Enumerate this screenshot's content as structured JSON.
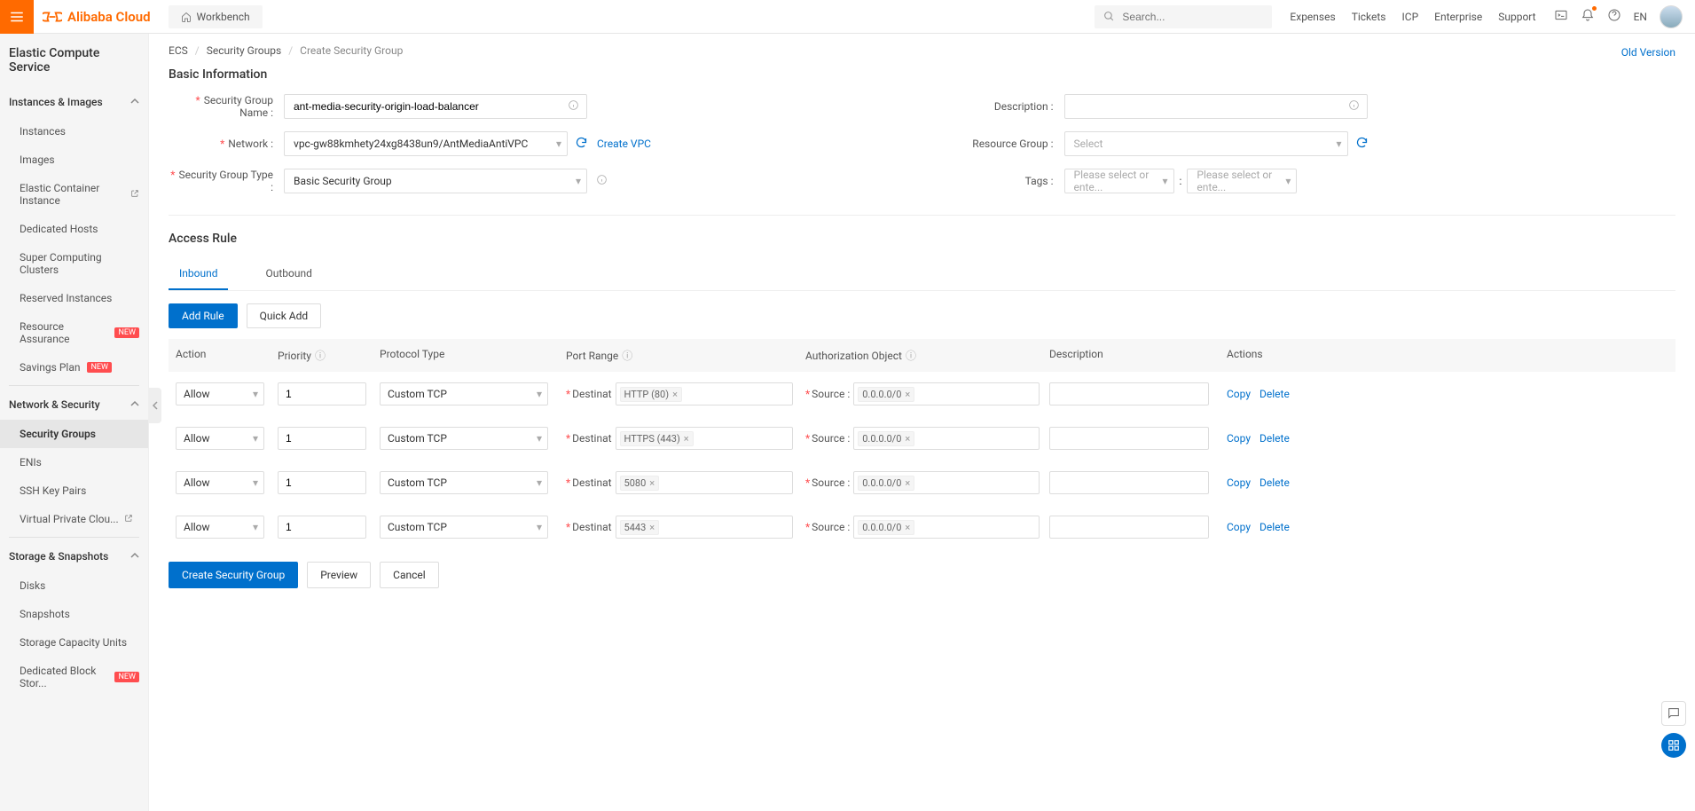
{
  "header": {
    "brand": "Alibaba Cloud",
    "workbench": "Workbench",
    "search_placeholder": "Search...",
    "links": [
      "Expenses",
      "Tickets",
      "ICP",
      "Enterprise",
      "Support"
    ],
    "lang": "EN"
  },
  "sidebar": {
    "title": "Elastic Compute Service",
    "sections": [
      {
        "label": "Instances & Images",
        "expanded": true,
        "items": [
          {
            "label": "Instances"
          },
          {
            "label": "Images"
          },
          {
            "label": "Elastic Container Instance",
            "external": true
          },
          {
            "label": "Dedicated Hosts"
          },
          {
            "label": "Super Computing Clusters"
          },
          {
            "label": "Reserved Instances"
          },
          {
            "label": "Resource Assurance",
            "badge": "NEW"
          },
          {
            "label": "Savings Plan",
            "badge": "NEW"
          }
        ]
      },
      {
        "label": "Network & Security",
        "expanded": true,
        "items": [
          {
            "label": "Security Groups",
            "active": true
          },
          {
            "label": "ENIs"
          },
          {
            "label": "SSH Key Pairs"
          },
          {
            "label": "Virtual Private Clou...",
            "external": true
          }
        ]
      },
      {
        "label": "Storage & Snapshots",
        "expanded": true,
        "items": [
          {
            "label": "Disks"
          },
          {
            "label": "Snapshots"
          },
          {
            "label": "Storage Capacity Units"
          },
          {
            "label": "Dedicated Block Stor...",
            "badge": "NEW"
          }
        ]
      }
    ]
  },
  "breadcrumb": {
    "items": [
      "ECS",
      "Security Groups",
      "Create Security Group"
    ]
  },
  "old_version": "Old Version",
  "basic": {
    "title": "Basic Information",
    "labels": {
      "name": "Security Group Name :",
      "description": "Description :",
      "network": "Network :",
      "resource_group": "Resource Group :",
      "type": "Security Group Type :",
      "tags": "Tags :"
    },
    "values": {
      "name": "ant-media-security-origin-load-balancer",
      "network": "vpc-gw88kmhety24xg8438un9/AntMediaAntiVPC",
      "type": "Basic Security Group"
    },
    "create_vpc": "Create VPC",
    "select_placeholder": "Select",
    "tag_placeholder": "Please select or ente..."
  },
  "access": {
    "title": "Access Rule",
    "tabs": {
      "inbound": "Inbound",
      "outbound": "Outbound"
    },
    "add_rule": "Add Rule",
    "quick_add": "Quick Add",
    "columns": {
      "action": "Action",
      "priority": "Priority",
      "protocol": "Protocol Type",
      "port": "Port Range",
      "auth": "Authorization Object",
      "desc": "Description",
      "actions": "Actions"
    },
    "port_label": "Destinat",
    "source_label": "Source :",
    "row_actions": {
      "copy": "Copy",
      "delete": "Delete"
    },
    "rows": [
      {
        "action": "Allow",
        "priority": "1",
        "protocol": "Custom TCP",
        "port": "HTTP (80)",
        "source": "0.0.0.0/0"
      },
      {
        "action": "Allow",
        "priority": "1",
        "protocol": "Custom TCP",
        "port": "HTTPS (443)",
        "source": "0.0.0.0/0"
      },
      {
        "action": "Allow",
        "priority": "1",
        "protocol": "Custom TCP",
        "port": "5080",
        "source": "0.0.0.0/0"
      },
      {
        "action": "Allow",
        "priority": "1",
        "protocol": "Custom TCP",
        "port": "5443",
        "source": "0.0.0.0/0"
      }
    ]
  },
  "bottom": {
    "create": "Create Security Group",
    "preview": "Preview",
    "cancel": "Cancel"
  }
}
